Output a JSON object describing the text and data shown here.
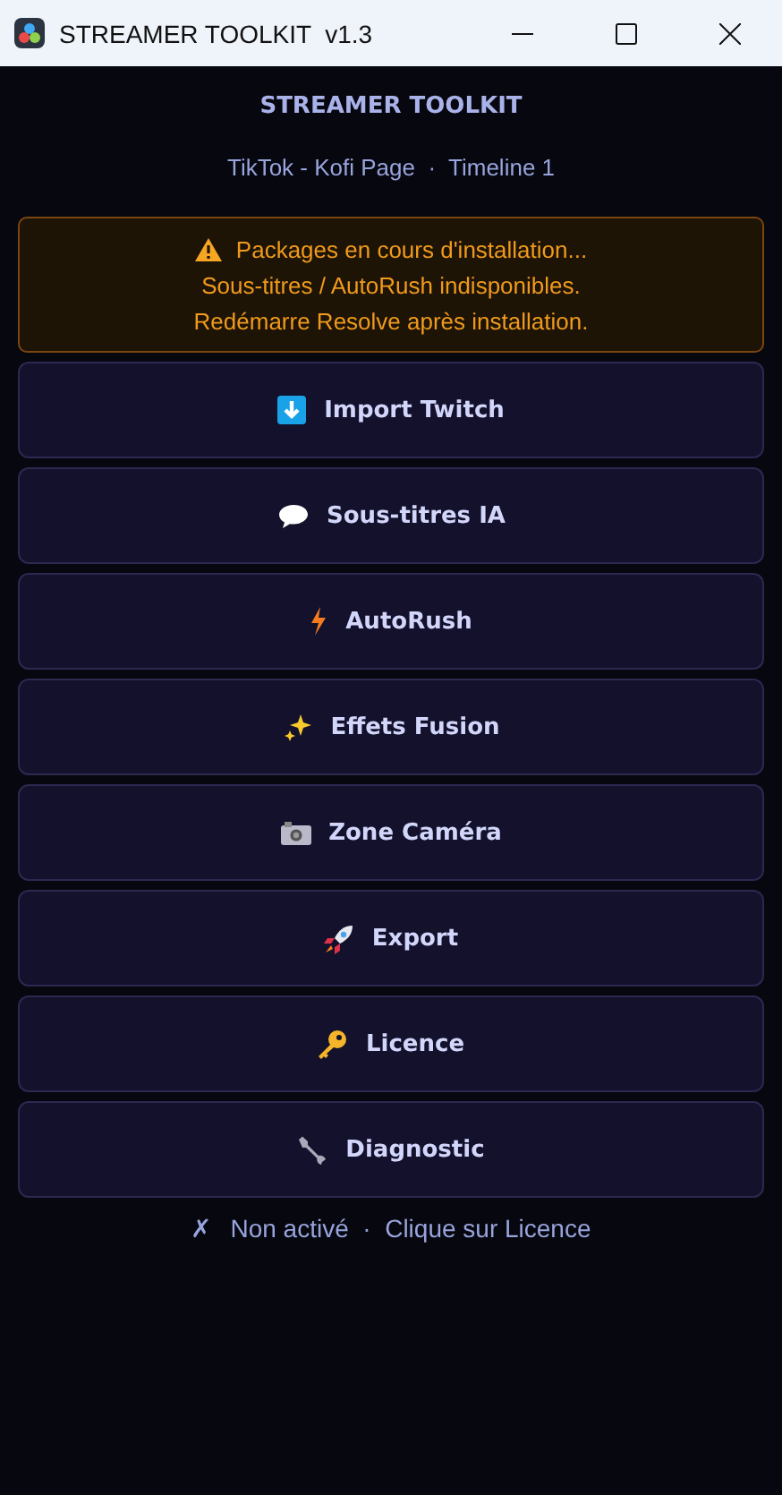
{
  "window": {
    "title": "STREAMER TOOLKIT  v1.3"
  },
  "header": {
    "title": "STREAMER TOOLKIT",
    "subtitle": "TikTok - Kofi Page  ·  Timeline 1"
  },
  "warning": {
    "lines": [
      "Packages en cours d'installation...",
      "Sous-titres / AutoRush indisponibles.",
      "Redémarre Resolve après installation."
    ]
  },
  "buttons": [
    {
      "label": "Import Twitch"
    },
    {
      "label": "Sous-titres IA"
    },
    {
      "label": "AutoRush"
    },
    {
      "label": "Effets Fusion"
    },
    {
      "label": "Zone Caméra"
    },
    {
      "label": "Export"
    },
    {
      "label": "Licence"
    },
    {
      "label": "Diagnostic"
    }
  ],
  "status": {
    "mark": "✗",
    "text": "Non activé  ·  Clique sur Licence"
  }
}
